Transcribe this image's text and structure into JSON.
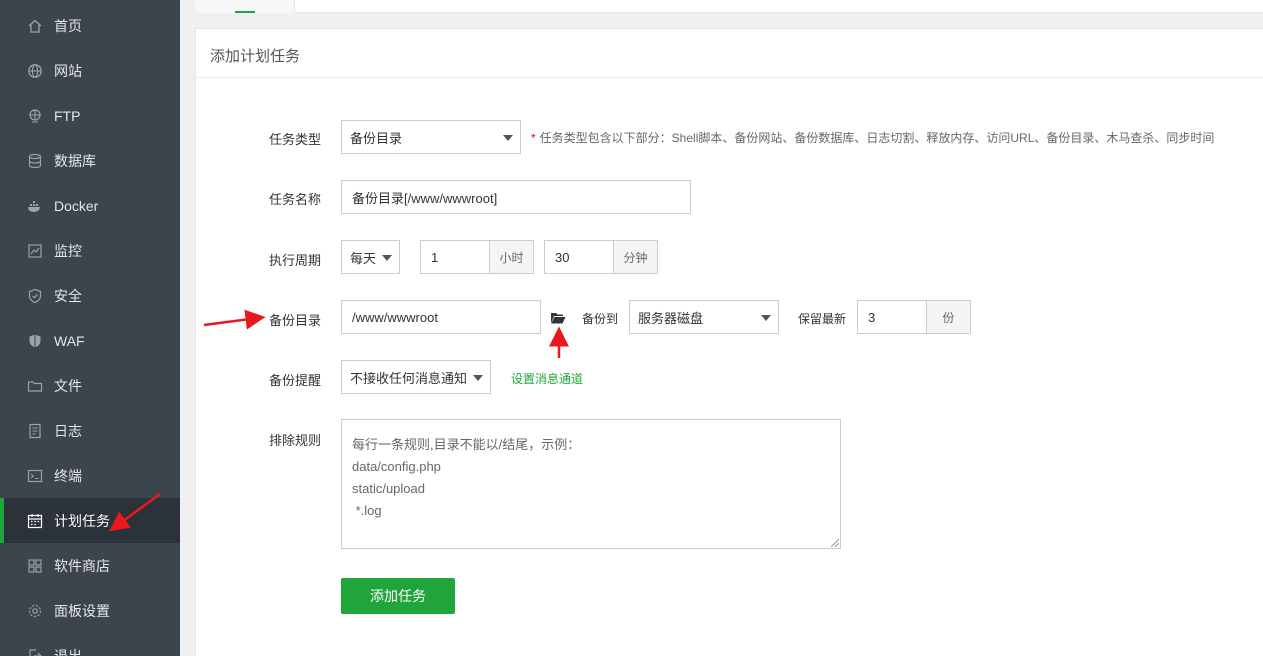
{
  "sidebar": {
    "items": [
      {
        "label": "首页",
        "icon": "home-icon"
      },
      {
        "label": "网站",
        "icon": "globe-icon"
      },
      {
        "label": "FTP",
        "icon": "ftp-icon"
      },
      {
        "label": "数据库",
        "icon": "database-icon"
      },
      {
        "label": "Docker",
        "icon": "docker-icon"
      },
      {
        "label": "监控",
        "icon": "monitor-icon"
      },
      {
        "label": "安全",
        "icon": "shield-icon"
      },
      {
        "label": "WAF",
        "icon": "waf-shield-icon"
      },
      {
        "label": "文件",
        "icon": "folder-icon"
      },
      {
        "label": "日志",
        "icon": "log-icon"
      },
      {
        "label": "终端",
        "icon": "terminal-icon"
      },
      {
        "label": "计划任务",
        "icon": "calendar-icon",
        "active": true
      },
      {
        "label": "软件商店",
        "icon": "grid-icon"
      },
      {
        "label": "面板设置",
        "icon": "gear-icon"
      },
      {
        "label": "退出",
        "icon": "logout-icon"
      }
    ]
  },
  "form": {
    "title": "添加计划任务",
    "task_type": {
      "label": "任务类型",
      "value": "备份目录",
      "hint_mark": "*",
      "hint": "任务类型包含以下部分：Shell脚本、备份网站、备份数据库、日志切割、释放内存、访问URL、备份目录、木马查杀、同步时间"
    },
    "task_name": {
      "label": "任务名称",
      "value": "备份目录[/www/wwwroot]"
    },
    "cycle": {
      "label": "执行周期",
      "period": "每天",
      "hour_value": "1",
      "hour_unit": "小时",
      "minute_value": "30",
      "minute_unit": "分钟"
    },
    "backup_dir": {
      "label": "备份目录",
      "value": "/www/wwwroot",
      "backup_to_label": "备份到",
      "backup_to_value": "服务器磁盘",
      "keep_label": "保留最新",
      "keep_value": "3",
      "keep_unit": "份"
    },
    "notify": {
      "label": "备份提醒",
      "value": "不接收任何消息通知",
      "link": "设置消息通道"
    },
    "exclude": {
      "label": "排除规则",
      "placeholder_lines": [
        "每行一条规则,目录不能以/结尾，示例：",
        "data/config.php",
        "static/upload",
        " *.log"
      ]
    },
    "submit_label": "添加任务"
  },
  "colors": {
    "accent": "#20a53a",
    "annotation_arrow": "#e8191c",
    "sidebar_bg": "#3c444d"
  }
}
